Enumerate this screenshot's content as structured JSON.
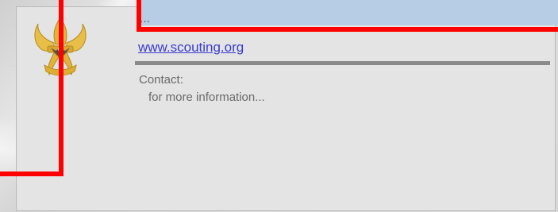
{
  "link": {
    "url_text": "www.scouting.org"
  },
  "contact": {
    "label": "Contact:",
    "info": "for more information..."
  },
  "header": {
    "cut_off_text": "..."
  },
  "colors": {
    "link": "#3b3bd0",
    "highlight": "#ff0000",
    "band": "#b7cde5"
  },
  "icons": {
    "logo": "fleur-de-lis-eagle-emblem"
  }
}
